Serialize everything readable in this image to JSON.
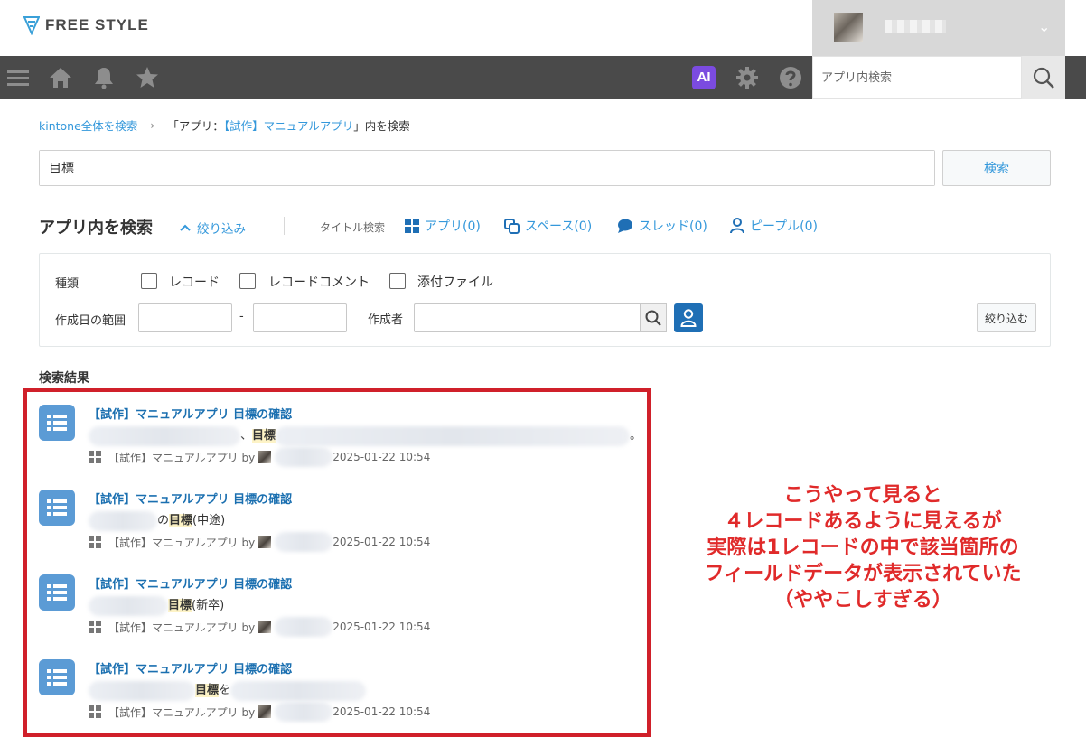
{
  "header": {
    "logo_text": "FREE STYLE",
    "user_chevron": "⌄"
  },
  "toolbar": {
    "ai_label": "AI",
    "search_placeholder": "アプリ内検索",
    "icons": [
      "menu-icon",
      "home-icon",
      "bell-icon",
      "star-icon",
      "gear-icon",
      "help-icon",
      "search-icon"
    ]
  },
  "breadcrumb": {
    "root": "kintone全体を検索",
    "separator": "›",
    "current_prefix": "「アプリ：",
    "current_app": "【試作】マニュアルアプリ",
    "current_suffix": "」内を検索"
  },
  "search": {
    "query": "目標",
    "button_label": "検索"
  },
  "section": {
    "heading": "アプリ内を検索",
    "filter_toggle": "絞り込み",
    "title_search_label": "タイトル検索",
    "categories": [
      {
        "label": "アプリ(0)",
        "icon": "apps-icon"
      },
      {
        "label": "スペース(0)",
        "icon": "space-icon"
      },
      {
        "label": "スレッド(0)",
        "icon": "thread-icon"
      },
      {
        "label": "ピープル(0)",
        "icon": "person-icon"
      }
    ]
  },
  "filter": {
    "type_label": "種類",
    "checkboxes": [
      "レコード",
      "レコードコメント",
      "添付ファイル"
    ],
    "date_range_label": "作成日の範囲",
    "date_separator": "-",
    "creator_label": "作成者",
    "narrow_button": "絞り込む"
  },
  "results_label": "検索結果",
  "results": [
    {
      "title": "【試作】マニュアルアプリ 目標の確認",
      "snippet_before": "、",
      "snippet_highlight": "目標",
      "snippet_after": "。",
      "meta_app": "【試作】マニュアルアプリ by",
      "meta_date": "2025-01-22 10:54"
    },
    {
      "title": "【試作】マニュアルアプリ 目標の確認",
      "snippet_before": "の",
      "snippet_highlight": "目標",
      "snippet_after": "(中途)",
      "meta_app": "【試作】マニュアルアプリ by",
      "meta_date": "2025-01-22 10:54"
    },
    {
      "title": "【試作】マニュアルアプリ 目標の確認",
      "snippet_before": "",
      "snippet_highlight": "目標",
      "snippet_after": "(新卒)",
      "meta_app": "【試作】マニュアルアプリ by",
      "meta_date": "2025-01-22 10:54"
    },
    {
      "title": "【試作】マニュアルアプリ 目標の確認",
      "snippet_before": "",
      "snippet_highlight": "目標",
      "snippet_after": "を",
      "meta_app": "【試作】マニュアルアプリ by",
      "meta_date": "2025-01-22 10:54"
    }
  ],
  "annotation": {
    "lines": [
      "こうやって見ると",
      "４レコードあるように見えるが",
      "実際は1レコードの中で該当箇所の",
      "フィールドデータが表示されていた",
      "（ややこしすぎる）"
    ],
    "color": "#e02a2a",
    "box_color": "#d0202a"
  },
  "colors": {
    "toolbar_bg": "#4a4a4a",
    "link_blue": "#3498db",
    "ai_purple": "#7b4be0",
    "result_icon_blue": "#5b9bd5"
  }
}
